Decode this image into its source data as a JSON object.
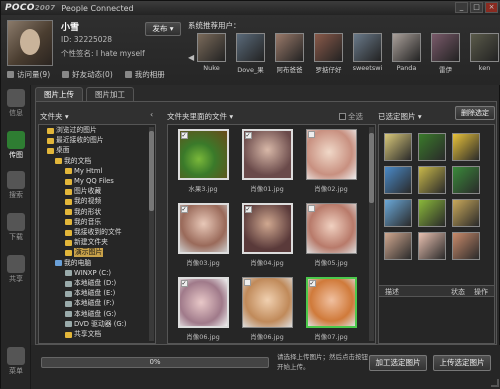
{
  "window": {
    "brand": "POCO",
    "brand_version": "2007",
    "title": "People Connected",
    "buttons": {
      "min": "_",
      "max": "□",
      "close": "×"
    }
  },
  "user": {
    "name": "小雪",
    "id": "ID: 32225028",
    "signature": "个性签名: I hate myself",
    "publish_label": "发布",
    "stats": [
      {
        "label": "访问量(9)",
        "icon": "bar-chart-icon"
      },
      {
        "label": "好友动态(0)",
        "icon": "friends-icon"
      },
      {
        "label": "我的相册",
        "icon": "album-icon"
      }
    ]
  },
  "recommended": {
    "title": "系统推荐用户：",
    "users": [
      {
        "name": "Nuke"
      },
      {
        "name": "Dove_果"
      },
      {
        "name": "阿布爸爸"
      },
      {
        "name": "罗掂仔好"
      },
      {
        "name": "sweetswi"
      },
      {
        "name": "Panda"
      },
      {
        "name": "雷伊"
      },
      {
        "name": "ken"
      }
    ]
  },
  "nav": [
    {
      "label": "信息",
      "icon": "message-icon"
    },
    {
      "label": "传图",
      "icon": "upload-photo-icon",
      "active": true
    },
    {
      "label": "搜索",
      "icon": "search-icon"
    },
    {
      "label": "下载",
      "icon": "download-icon"
    },
    {
      "label": "共享",
      "icon": "share-icon"
    },
    {
      "label": "菜单",
      "icon": "menu-icon"
    }
  ],
  "tabs": [
    {
      "label": "图片上传",
      "active": true
    },
    {
      "label": "图片加工",
      "active": false
    }
  ],
  "folders": {
    "label": "文件夹",
    "items": [
      {
        "label": "浏览过的图片",
        "icon": "folder"
      },
      {
        "label": "最近接收的图片",
        "icon": "folder"
      },
      {
        "label": "桌面",
        "icon": "desktop"
      },
      {
        "label": "我的文档",
        "icon": "folder"
      },
      {
        "label": "My Html",
        "icon": "folder"
      },
      {
        "label": "My QQ Files",
        "icon": "folder"
      },
      {
        "label": "图片收藏",
        "icon": "folder"
      },
      {
        "label": "我的视频",
        "icon": "folder"
      },
      {
        "label": "我的形状",
        "icon": "folder"
      },
      {
        "label": "我的音乐",
        "icon": "folder"
      },
      {
        "label": "我接收到的文件",
        "icon": "folder"
      },
      {
        "label": "新建文件夹",
        "icon": "folder"
      },
      {
        "label": "演示图片",
        "icon": "folder",
        "selected": true
      },
      {
        "label": "我的电脑",
        "icon": "pc"
      },
      {
        "label": "WINXP (C:)",
        "icon": "drive"
      },
      {
        "label": "本地磁盘 (D:)",
        "icon": "drive"
      },
      {
        "label": "本地磁盘 (E:)",
        "icon": "drive"
      },
      {
        "label": "本地磁盘 (F:)",
        "icon": "drive"
      },
      {
        "label": "本地磁盘 (G:)",
        "icon": "drive"
      },
      {
        "label": "DVD 驱动器 (G:)",
        "icon": "drive"
      },
      {
        "label": "共享文档",
        "icon": "folder"
      }
    ]
  },
  "files": {
    "label": "文件夹里面的文件",
    "select_all": "全选",
    "items": [
      {
        "name": "水果3.jpg",
        "checked": true
      },
      {
        "name": "肖像01.jpg",
        "checked": true
      },
      {
        "name": "肖像02.jpg",
        "checked": false
      },
      {
        "name": "肖像03.jpg",
        "checked": true
      },
      {
        "name": "肖像04.jpg",
        "checked": true
      },
      {
        "name": "肖像05.jpg",
        "checked": false
      },
      {
        "name": "肖像06.jpg",
        "checked": true
      },
      {
        "name": "肖像06.jpg",
        "checked": false
      },
      {
        "name": "肖像07.jpg",
        "checked": true
      }
    ]
  },
  "selected": {
    "label": "已选定图片",
    "delete_label": "删除选定",
    "columns": [
      "描述",
      "状态",
      "操作"
    ]
  },
  "bottom": {
    "progress_text": "0%",
    "progress": 0,
    "hint": "请选择上传图片；然后点击按钮开始上传。",
    "add_label": "加工选定图片",
    "upload_label": "上传选定图片"
  }
}
